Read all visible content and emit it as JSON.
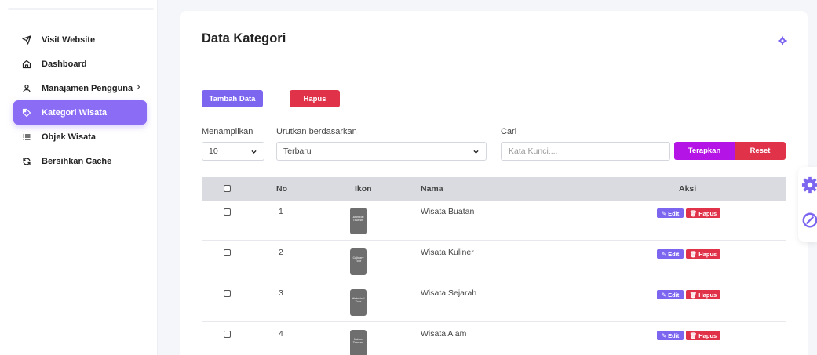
{
  "sidebar": {
    "items": [
      {
        "label": "Visit Website",
        "icon": "send-icon"
      },
      {
        "label": "Dashboard",
        "icon": "home-icon"
      },
      {
        "label": "Manajamen Pengguna",
        "icon": "user-icon"
      },
      {
        "label": "Kategori Wisata",
        "icon": "tag-icon",
        "active": true
      },
      {
        "label": "Objek Wisata",
        "icon": "list-icon"
      },
      {
        "label": "Bersihkan Cache",
        "icon": "refresh-icon"
      }
    ]
  },
  "main": {
    "title": "Data Kategori",
    "buttons": {
      "add": "Tambah Data",
      "delete": "Hapus"
    },
    "filters": {
      "show_label": "Menampilkan",
      "show_value": "10",
      "sort_label": "Urutkan berdasarkan",
      "sort_value": "Terbaru",
      "search_label": "Cari",
      "search_placeholder": "Kata Kunci....",
      "apply": "Terapkan",
      "reset": "Reset"
    },
    "table": {
      "headers": {
        "no": "No",
        "icon": "Ikon",
        "name": "Nama",
        "action": "Aksi"
      },
      "rows": [
        {
          "no": "1",
          "name": "Wisata Buatan",
          "thumb": [
            "Artificial",
            "Tourism"
          ]
        },
        {
          "no": "2",
          "name": "Wisata Kuliner",
          "thumb": [
            "Culinary",
            "Tour"
          ]
        },
        {
          "no": "3",
          "name": "Wisata Sejarah",
          "thumb": [
            "Historical",
            "Tour"
          ]
        },
        {
          "no": "4",
          "name": "Wisata Alam",
          "thumb": [
            "Nature",
            "Tourism"
          ]
        }
      ],
      "edit_label": "Edit",
      "delete_label": "Hapus"
    }
  },
  "colors": {
    "accent": "#8b6cf5",
    "danger": "#e0334a",
    "apply": "#b514e6"
  }
}
